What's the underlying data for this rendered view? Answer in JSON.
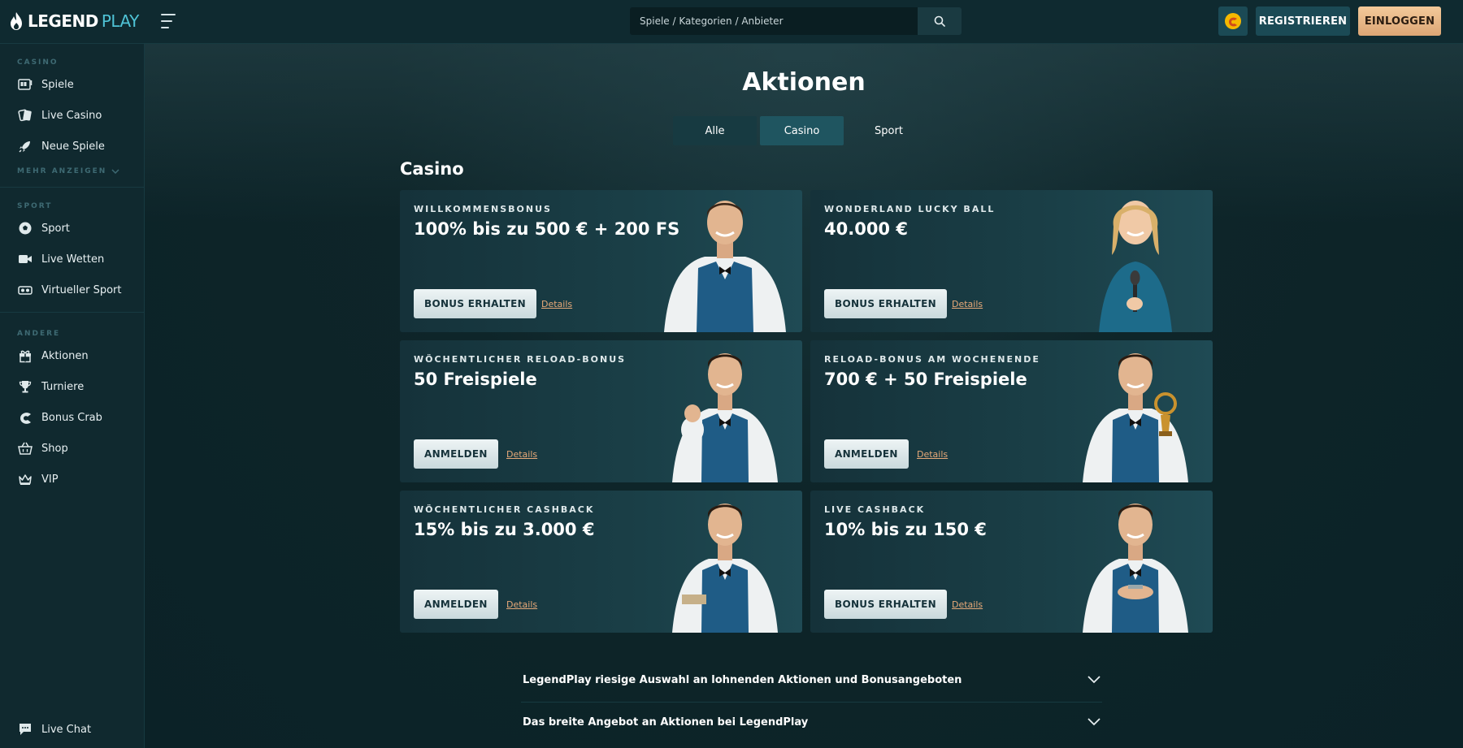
{
  "header": {
    "logo_main": "LEGEND",
    "logo_accent": "PLAY",
    "search_placeholder": "Spiele / Kategorien / Anbieter",
    "register_label": "REGISTRIEREN",
    "login_label": "EINLOGGEN"
  },
  "sidebar": {
    "casino_label": "CASINO",
    "casino_items": [
      {
        "label": "Spiele",
        "icon": "slot-machine-icon"
      },
      {
        "label": "Live Casino",
        "icon": "cards-icon"
      },
      {
        "label": "Neue Spiele",
        "icon": "rocket-icon"
      }
    ],
    "more_label": "MEHR ANZEIGEN",
    "sport_label": "SPORT",
    "sport_items": [
      {
        "label": "Sport",
        "icon": "soccer-ball-icon"
      },
      {
        "label": "Live Wetten",
        "icon": "video-icon"
      },
      {
        "label": "Virtueller Sport",
        "icon": "vr-headset-icon"
      }
    ],
    "other_label": "ANDERE",
    "other_items": [
      {
        "label": "Aktionen",
        "icon": "gift-icon"
      },
      {
        "label": "Turniere",
        "icon": "trophy-icon"
      },
      {
        "label": "Bonus Crab",
        "icon": "crab-icon"
      },
      {
        "label": "Shop",
        "icon": "basket-icon"
      },
      {
        "label": "VIP",
        "icon": "crown-icon"
      }
    ],
    "live_chat_label": "Live Chat"
  },
  "main": {
    "page_title": "Aktionen",
    "tabs": [
      "Alle",
      "Casino",
      "Sport"
    ],
    "active_tab": "Casino",
    "section_title": "Casino",
    "cards": [
      {
        "kicker": "WILLKOMMENSBONUS",
        "amount": "100% bis zu 500 € + 200 FS",
        "cta": "BONUS ERHALTEN",
        "details": "Details"
      },
      {
        "kicker": "WONDERLAND LUCKY BALL",
        "amount": "40.000 €",
        "cta": "BONUS ERHALTEN",
        "details": "Details"
      },
      {
        "kicker": "WÖCHENTLICHER RELOAD-BONUS",
        "amount": "50 Freispiele",
        "cta": "ANMELDEN",
        "details": "Details"
      },
      {
        "kicker": "RELOAD-BONUS AM WOCHENENDE",
        "amount": "700 € + 50 Freispiele",
        "cta": "ANMELDEN",
        "details": "Details"
      },
      {
        "kicker": "WÖCHENTLICHER CASHBACK",
        "amount": "15% bis zu 3.000 €",
        "cta": "ANMELDEN",
        "details": "Details"
      },
      {
        "kicker": "LIVE CASHBACK",
        "amount": "10% bis zu 150 €",
        "cta": "BONUS ERHALTEN",
        "details": "Details"
      }
    ],
    "faq": [
      "LegendPlay riesige Auswahl an lohnenden Aktionen und Bonusangeboten",
      "Das breite Angebot an Aktionen bei LegendPlay"
    ]
  },
  "colors": {
    "accent": "#4fc3d6",
    "login_button": "#dca675",
    "details_link": "#e6a978",
    "vest_blue": "#1f5c86"
  }
}
